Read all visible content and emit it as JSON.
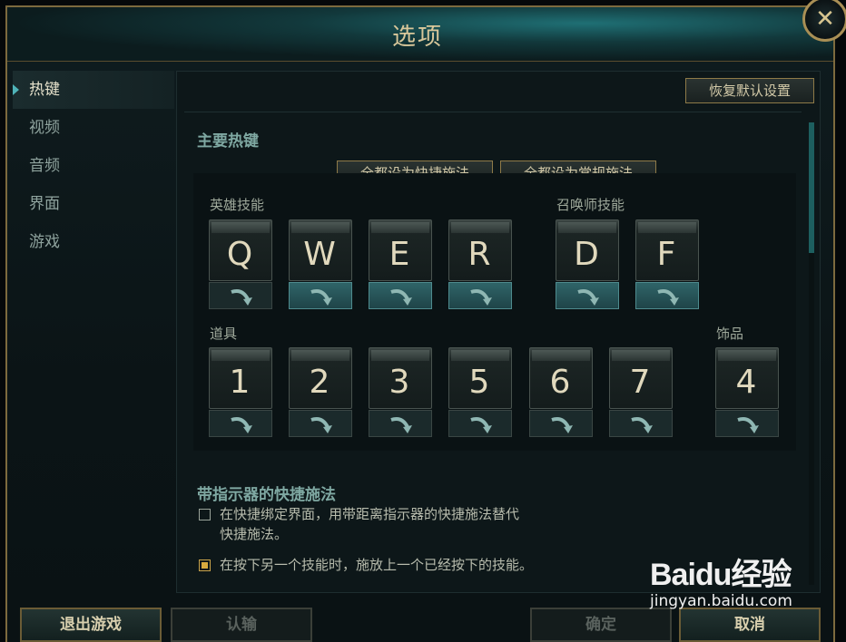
{
  "window": {
    "title": "选项",
    "close_label": "✕"
  },
  "sidebar": {
    "items": [
      {
        "label": "热键",
        "active": true
      },
      {
        "label": "视频"
      },
      {
        "label": "音频"
      },
      {
        "label": "界面"
      },
      {
        "label": "游戏"
      }
    ]
  },
  "main": {
    "restore_defaults": "恢复默认设置",
    "section_hotkeys": "主要热键",
    "set_all_quick": "全都设为快捷施法",
    "set_all_normal": "全都设为常规施法",
    "champion_abilities_label": "英雄技能",
    "summoner_spells_label": "召唤师技能",
    "items_label": "道具",
    "trinket_label": "饰品",
    "champion_keys": [
      {
        "key": "Q",
        "quick": false
      },
      {
        "key": "W",
        "quick": true
      },
      {
        "key": "E",
        "quick": true
      },
      {
        "key": "R",
        "quick": true
      }
    ],
    "summoner_keys": [
      {
        "key": "D",
        "quick": true
      },
      {
        "key": "F",
        "quick": true
      }
    ],
    "item_keys": [
      {
        "key": "1",
        "quick": false
      },
      {
        "key": "2",
        "quick": false
      },
      {
        "key": "3",
        "quick": false
      },
      {
        "key": "5",
        "quick": false
      },
      {
        "key": "6",
        "quick": false
      },
      {
        "key": "7",
        "quick": false
      }
    ],
    "trinket_key": {
      "key": "4",
      "quick": false
    },
    "section_indicator": "带指示器的快捷施法",
    "option1_line1": "在快捷绑定界面，用带距离指示器的快捷施法替代",
    "option1_line2": "快捷施法。",
    "option1_checked": false,
    "option2": "在按下另一个技能时，施放上一个已经按下的技能。",
    "option2_checked": true
  },
  "footer": {
    "exit_game": "退出游戏",
    "surrender": "认输",
    "ok": "确定",
    "cancel": "取消"
  },
  "watermark": {
    "logo": "Baidu经验",
    "url": "jingyan.baidu.com"
  },
  "colors": {
    "accent_gold": "#8e7a48",
    "accent_teal": "#2f6468",
    "text_gold": "#d9c79a"
  }
}
